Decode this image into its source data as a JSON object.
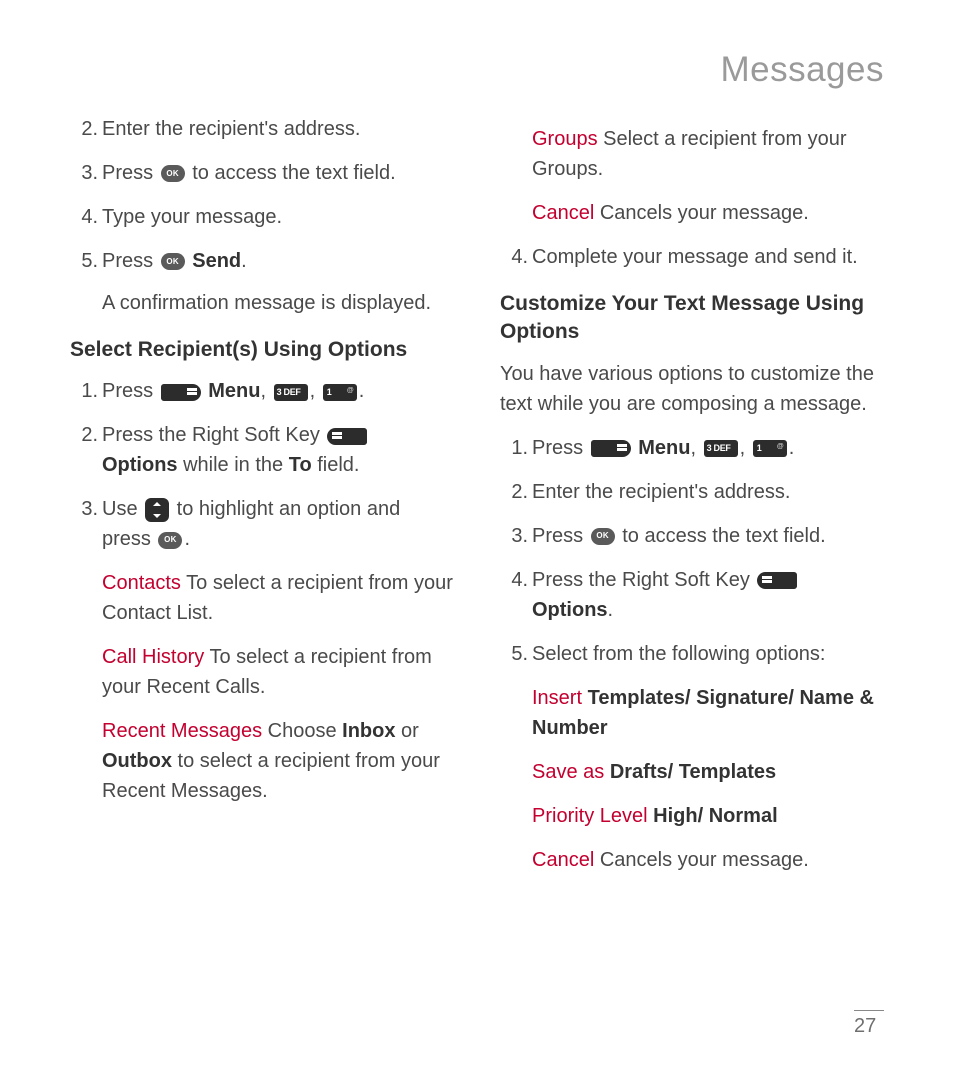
{
  "pageTitle": "Messages",
  "pageNumber": "27",
  "left": {
    "topList": {
      "start": 1,
      "items": [
        {
          "text": "Enter the recipient's address."
        },
        {
          "pre": "Press ",
          "iconA": "ok",
          "post": " to access the text field."
        },
        {
          "text": "Type your message."
        },
        {
          "pre": "Press ",
          "iconA": "ok",
          "postBold": " Send",
          "postTail": "."
        }
      ],
      "note": "A confirmation message is displayed."
    },
    "heading1": "Select Recipient(s) Using Options",
    "selectList": {
      "items": [
        {
          "pre": "Press ",
          "iconA": "menu",
          "midBold": " Menu",
          "sep": ", ",
          "iconB": "3def",
          "sep2": ", ",
          "iconC": "1",
          "postTail": "."
        },
        {
          "pre": "Press the Right Soft Key ",
          "iconA": "softkey",
          "br": true,
          "boldA": "Options",
          "mid2": " while in the ",
          "boldB": "To",
          "postTail": " field."
        },
        {
          "pre": "Use ",
          "iconA": "nav",
          "mid": " to highlight an option and press ",
          "iconB": "ok",
          "postTail": "."
        }
      ],
      "options": [
        {
          "name": "Contacts",
          "desc": " To select a recipient from your Contact List."
        },
        {
          "name": "Call History",
          "desc": " To select a recipient from your Recent Calls."
        },
        {
          "name": "Recent Messages",
          "descPre": " Choose ",
          "boldA": "Inbox",
          "mid": " or ",
          "boldB": "Outbox",
          "descPost": " to select a recipient from your Recent Messages."
        }
      ]
    }
  },
  "right": {
    "topOptions": [
      {
        "name": "Groups",
        "desc": " Select a recipient from your Groups."
      },
      {
        "name": "Cancel",
        "desc": " Cancels your message."
      }
    ],
    "topListContinue": {
      "start": 3,
      "items": [
        {
          "text": "Complete your message and send it."
        }
      ]
    },
    "heading2": "Customize Your Text Message Using Options",
    "intro": "You have various options to customize the text while you are composing a message.",
    "custList": {
      "items": [
        {
          "pre": "Press ",
          "iconA": "menu",
          "midBold": " Menu",
          "sep": ", ",
          "iconB": "3def",
          "sep2": ", ",
          "iconC": "1",
          "postTail": "."
        },
        {
          "text": "Enter the recipient's address."
        },
        {
          "pre": "Press ",
          "iconA": "ok",
          "post": " to access the text field."
        },
        {
          "pre": "Press the Right Soft Key ",
          "iconA": "softkey",
          "br": true,
          "boldA": "Options",
          "postTail": "."
        },
        {
          "text": "Select from the following options:"
        }
      ],
      "options": [
        {
          "name": "Insert",
          "boldRest": " Templates/ Signature/ Name & Number"
        },
        {
          "name": "Save as",
          "boldRest": " Drafts/ Templates"
        },
        {
          "name": "Priority Level",
          "boldRest": " High/ Normal"
        },
        {
          "name": "Cancel",
          "desc": " Cancels your message."
        }
      ]
    }
  }
}
